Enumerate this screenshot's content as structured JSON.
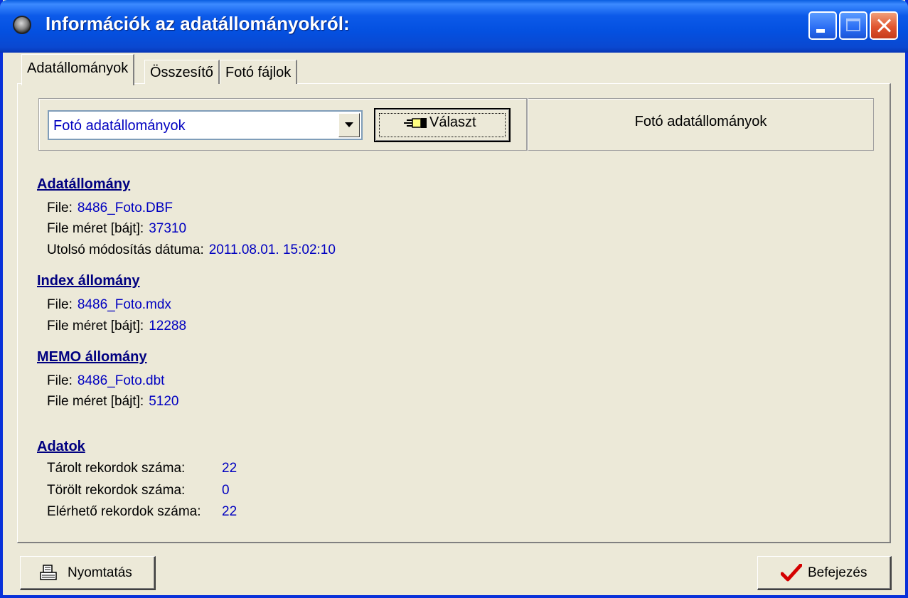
{
  "window": {
    "title": "Információk az adatállományokról:",
    "app_icon": "gear-app-icon",
    "controls": [
      "minimize-icon",
      "maximize-icon",
      "close-icon"
    ]
  },
  "tabs": [
    {
      "label": "Adatállományok",
      "active": true
    },
    {
      "label": "Összesítő",
      "active": false
    },
    {
      "label": "Fotó fájlok",
      "active": false
    }
  ],
  "selector": {
    "combo_value": "Fotó adatállományok",
    "button_label": "Választ",
    "button_icon": "pointing-hand-icon",
    "caption": "Fotó adatállományok"
  },
  "adatallomany": {
    "heading": "Adatállomány",
    "file_label": "File:",
    "file_value": "8486_Foto.DBF",
    "size_label": "File méret [bájt]:",
    "size_value": "37310",
    "modified_label": "Utolsó módosítás dátuma:",
    "modified_value": "2011.08.01. 15:02:10"
  },
  "index": {
    "heading": "Index állomány",
    "file_label": "File:",
    "file_value": "8486_Foto.mdx",
    "size_label": "File méret [bájt]:",
    "size_value": "12288"
  },
  "memo": {
    "heading": "MEMO állomány",
    "file_label": "File:",
    "file_value": "8486_Foto.dbt",
    "size_label": "File méret [bájt]:",
    "size_value": "5120"
  },
  "adatok": {
    "heading": "Adatok",
    "stored_label": "Tárolt rekordok száma:",
    "stored_value": "22",
    "deleted_label": "Törölt rekordok száma:",
    "deleted_value": "0",
    "available_label": "Elérhető rekordok száma:",
    "available_value": "22"
  },
  "footer": {
    "print_label": "Nyomtatás",
    "print_icon": "printer-icon",
    "finish_label": "Befejezés",
    "finish_icon": "checkmark-icon"
  },
  "colors": {
    "titlebar": "#0450e0",
    "face": "#ece9d8",
    "value_text": "#0000c0",
    "heading_text": "#000080",
    "checkmark": "#d40000"
  }
}
